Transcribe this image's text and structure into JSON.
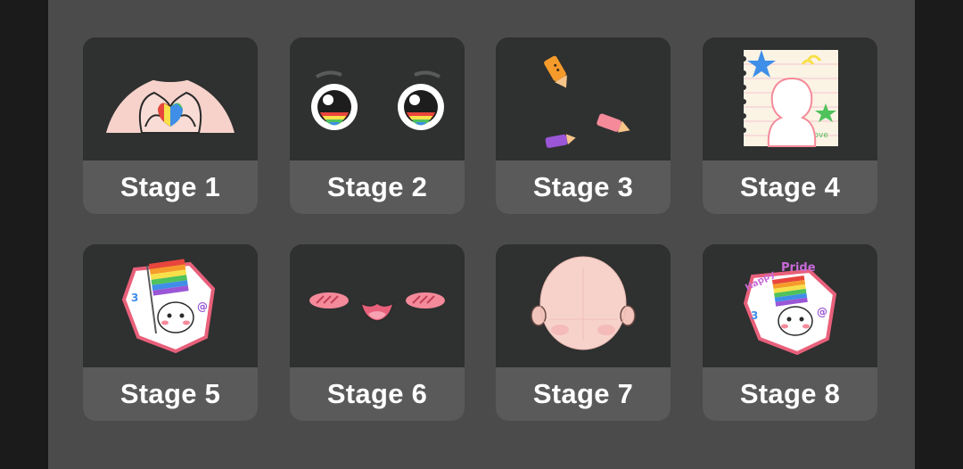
{
  "stages": [
    {
      "label": "Stage 1",
      "icon": "heart-hands-icon"
    },
    {
      "label": "Stage 2",
      "icon": "rainbow-eyes-icon"
    },
    {
      "label": "Stage 3",
      "icon": "crayons-icon"
    },
    {
      "label": "Stage 4",
      "icon": "notebook-silhouette-icon"
    },
    {
      "label": "Stage 5",
      "icon": "pride-flag-sticker-icon"
    },
    {
      "label": "Stage 6",
      "icon": "blush-mouth-icon"
    },
    {
      "label": "Stage 7",
      "icon": "bald-head-icon"
    },
    {
      "label": "Stage 8",
      "icon": "happy-pride-sticker-icon"
    }
  ],
  "colors": {
    "panel": "#4b4b4b",
    "card": "#2f3030",
    "label_bg": "#5a5a5a",
    "label_text": "#ffffff",
    "skin": "#f6d2cb",
    "blush": "#f48a9a",
    "rainbow": [
      "#e8453c",
      "#f59b2b",
      "#f7e04a",
      "#4fc25b",
      "#3f8ee8",
      "#9a56d6"
    ]
  }
}
